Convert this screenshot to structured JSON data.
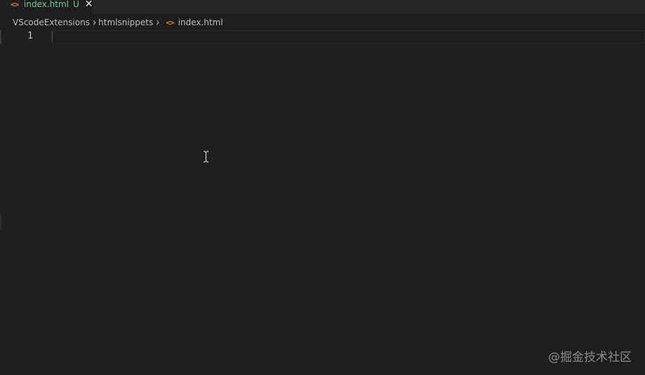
{
  "tab": {
    "label": "index.html",
    "status": "U",
    "file_icon": "html-file-icon",
    "close_icon": "close-icon",
    "file_icon_glyph": "<>"
  },
  "breadcrumb": {
    "items": [
      "VScodeExtensions",
      "htmlsnippets",
      "index.html"
    ],
    "separator_icon": "chevron-right-icon"
  },
  "editor": {
    "line_numbers": [
      "1"
    ],
    "content": ""
  },
  "watermark": {
    "text": "@掘金技术社区"
  },
  "colors": {
    "background": "#1e1e1e",
    "tabbar": "#252526",
    "modified_green": "#73c991",
    "html_icon_orange": "#e37933",
    "breadcrumb_text": "#bdbdbd"
  }
}
